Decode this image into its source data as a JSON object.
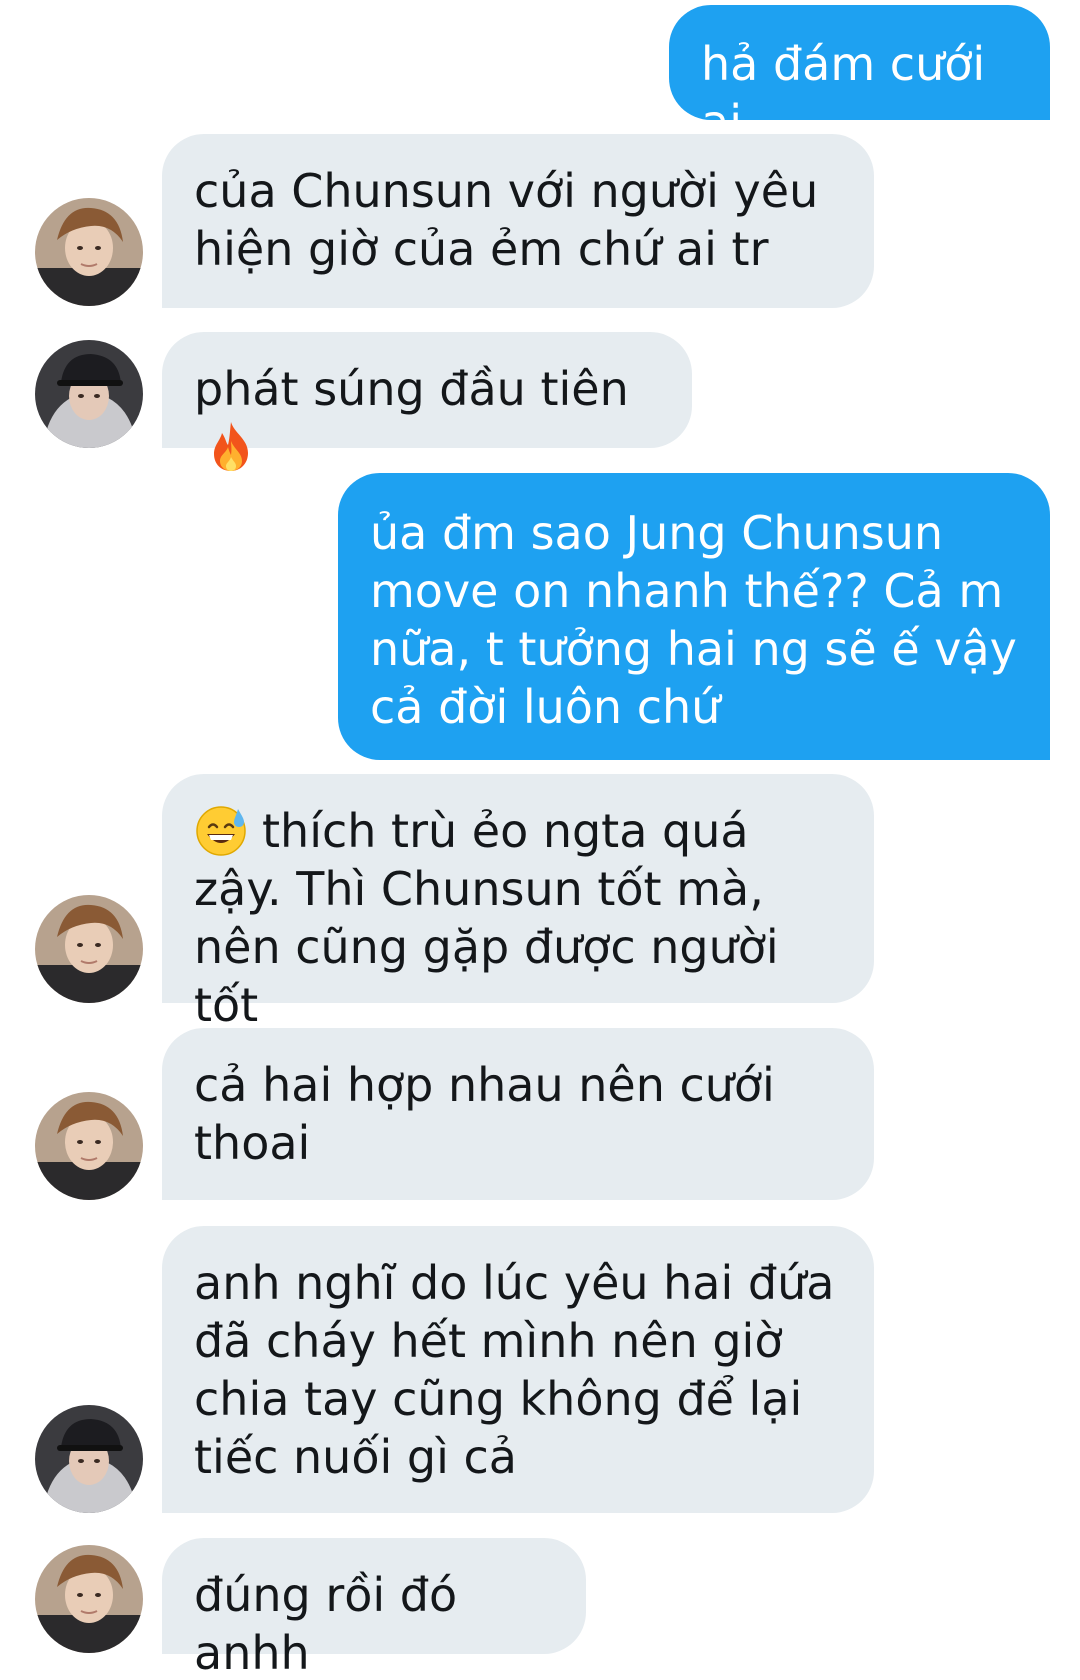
{
  "messages": [
    {
      "direction": "sent",
      "text": "hả đám cưới ai"
    },
    {
      "direction": "received",
      "text": "của Chunsun với người yêu hiện giờ của ẻm chứ ai tr"
    },
    {
      "direction": "received",
      "text": "phát súng đầu tiên",
      "emoji": "fire-emoji"
    },
    {
      "direction": "sent",
      "text": "ủa đm sao Jung Chunsun move on nhanh thế?? Cả m nữa, t tưởng hai ng sẽ ế vậy cả đời luôn chứ"
    },
    {
      "direction": "received",
      "text": "thích trù ẻo ngta quá zậy. Thì Chunsun tốt mà, nên cũng gặp được người tốt",
      "emoji": "grinning-sweat-emoji"
    },
    {
      "direction": "received",
      "text": "cả hai hợp nhau nên cưới thoai"
    },
    {
      "direction": "received",
      "text": "anh nghĩ do lúc yêu hai đứa đã cháy hết mình nên giờ chia tay cũng không để lại tiếc nuối gì cả"
    },
    {
      "direction": "received",
      "text": "đúng rồi đó anhh"
    }
  ],
  "colors": {
    "sent_bubble": "#1ea1f1",
    "received_bubble": "#e6ecf0",
    "received_text": "#14171a"
  },
  "icons": [
    "avatar-brown-hair",
    "avatar-cap-hood",
    "fire-emoji",
    "grinning-sweat-emoji"
  ]
}
